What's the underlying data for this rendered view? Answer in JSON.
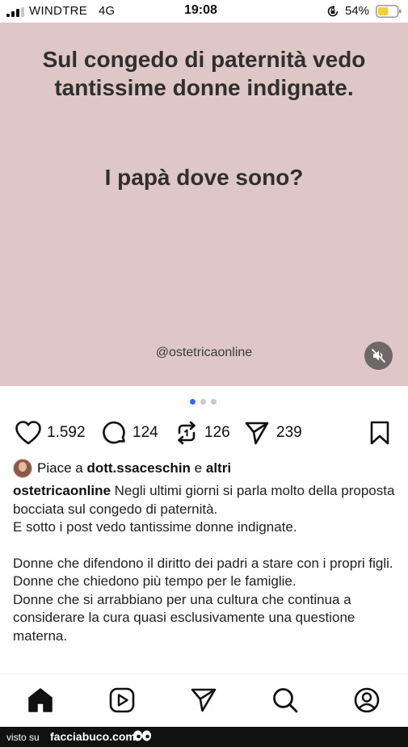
{
  "status_bar": {
    "carrier": "WINDTRE",
    "network": "4G",
    "time": "19:08",
    "battery": "54%",
    "battery_level": 0.54,
    "icons": [
      "signal-bars-icon",
      "orientation-lock-icon",
      "battery-icon"
    ]
  },
  "post": {
    "headline": "Sul congedo di paternità vedo tantissime donne indignate.",
    "question": "I papà dove sono?",
    "handle": "@ostetricaonline",
    "background_color": "#e0c7c7",
    "carousel": {
      "count": 3,
      "active": 0
    },
    "mute_icon": "speaker-muted-icon"
  },
  "actions": {
    "likes": "1.592",
    "comments": "124",
    "reposts": "126",
    "shares": "239",
    "icons": [
      "heart-icon",
      "comment-icon",
      "repost-icon",
      "share-icon",
      "bookmark-icon"
    ]
  },
  "liked_by": {
    "prefix": "Piace a",
    "user": "dott.ssaceschin",
    "connector": "e",
    "others": "altri"
  },
  "caption": {
    "username": "ostetricaonline",
    "paragraphs": [
      "Negli ultimi giorni si parla molto della proposta bocciata sul congedo di paternità.",
      "E sotto i post vedo tantissime donne indignate.",
      "Donne che difendono il diritto dei padri a stare con i propri figli.",
      "Donne che chiedono più tempo per le famiglie.",
      "Donne che si arrabbiano per una cultura che continua a considerare la cura quasi esclusivamente una questione materna."
    ]
  },
  "tab_bar": {
    "icons": [
      "home-icon",
      "reels-icon",
      "direct-icon",
      "search-icon",
      "profile-icon"
    ]
  },
  "watermark": {
    "prefix": "visto su",
    "site": "facciabuco.com"
  },
  "colors": {
    "post_background": "#e0c7c7",
    "carousel_active": "#3b66f0",
    "battery_fill": "#f5cf3a"
  }
}
